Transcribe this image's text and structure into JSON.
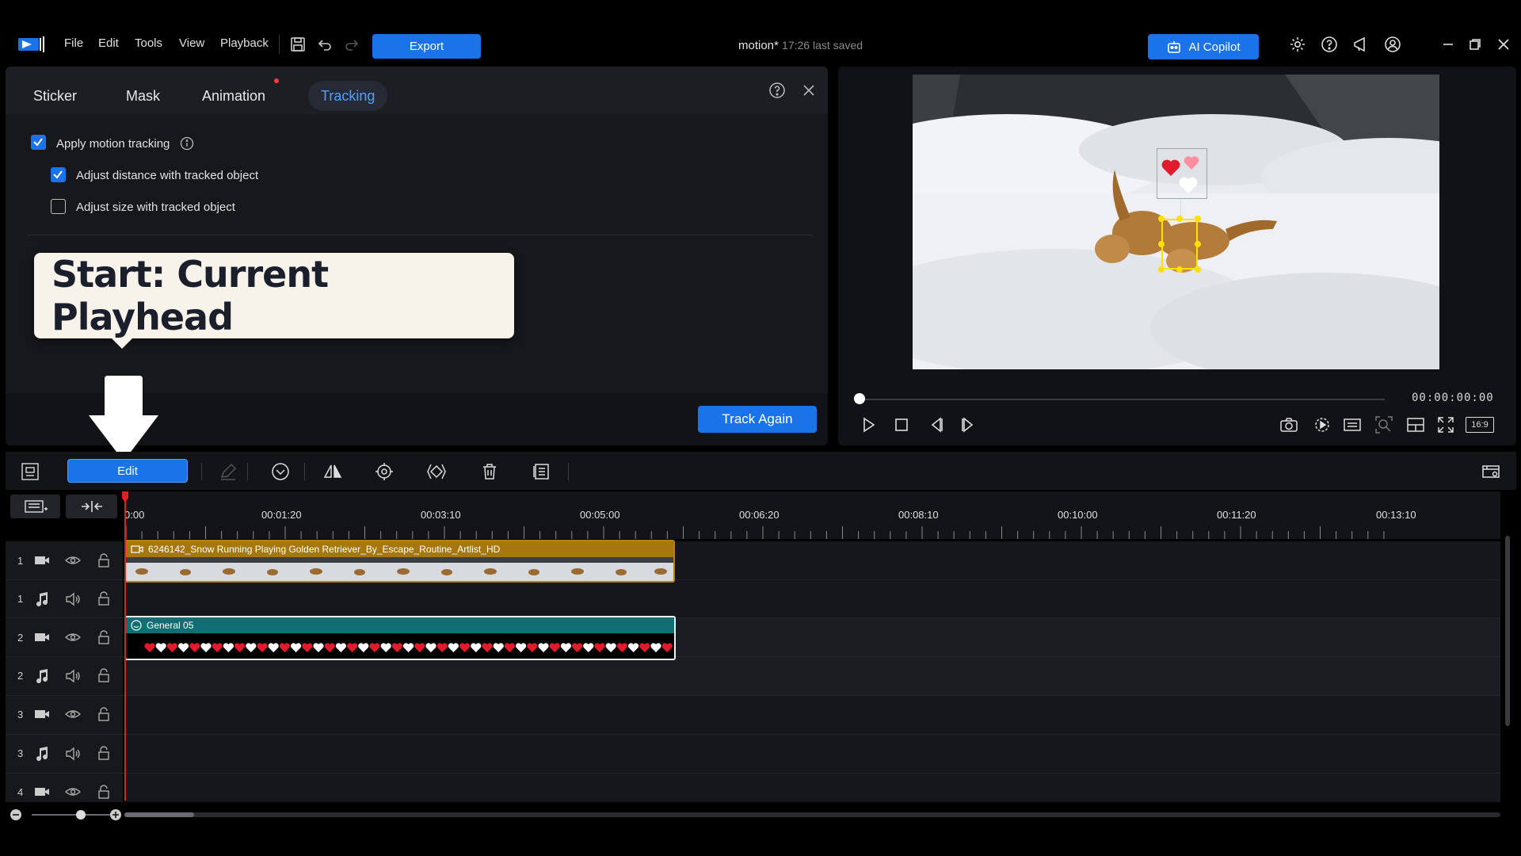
{
  "app": {
    "menus": [
      "File",
      "Edit",
      "Tools",
      "View",
      "Playback"
    ],
    "export_label": "Export",
    "project_name": "motion*",
    "saved_text": "17:26 last saved",
    "copilot_label": "AI Copilot",
    "accent": "#1a73e8"
  },
  "panel": {
    "tabs": [
      "Sticker",
      "Mask",
      "Animation",
      "Tracking"
    ],
    "active_tab": "Tracking",
    "options": {
      "apply_motion": "Apply motion tracking",
      "adjust_distance": "Adjust distance with tracked object",
      "adjust_size": "Adjust size with tracked object"
    },
    "callout": "Start: Current Playhead",
    "track_again_label": "Track Again"
  },
  "preview": {
    "timecode": "00:00:00:00",
    "aspect": "16:9"
  },
  "timeline": {
    "edit_label": "Edit",
    "ruler": [
      "0:00",
      "00:01:20",
      "00:03:10",
      "00:05:00",
      "00:06:20",
      "00:08:10",
      "00:10:00",
      "00:11:20",
      "00:13:10"
    ],
    "tracks": [
      "1",
      "1",
      "2",
      "2",
      "3",
      "3",
      "4"
    ],
    "video_clip": "6246142_Snow Running Playing Golden Retriever_By_Escape_Routine_Artlist_HD",
    "sticker_clip": "General 05"
  }
}
